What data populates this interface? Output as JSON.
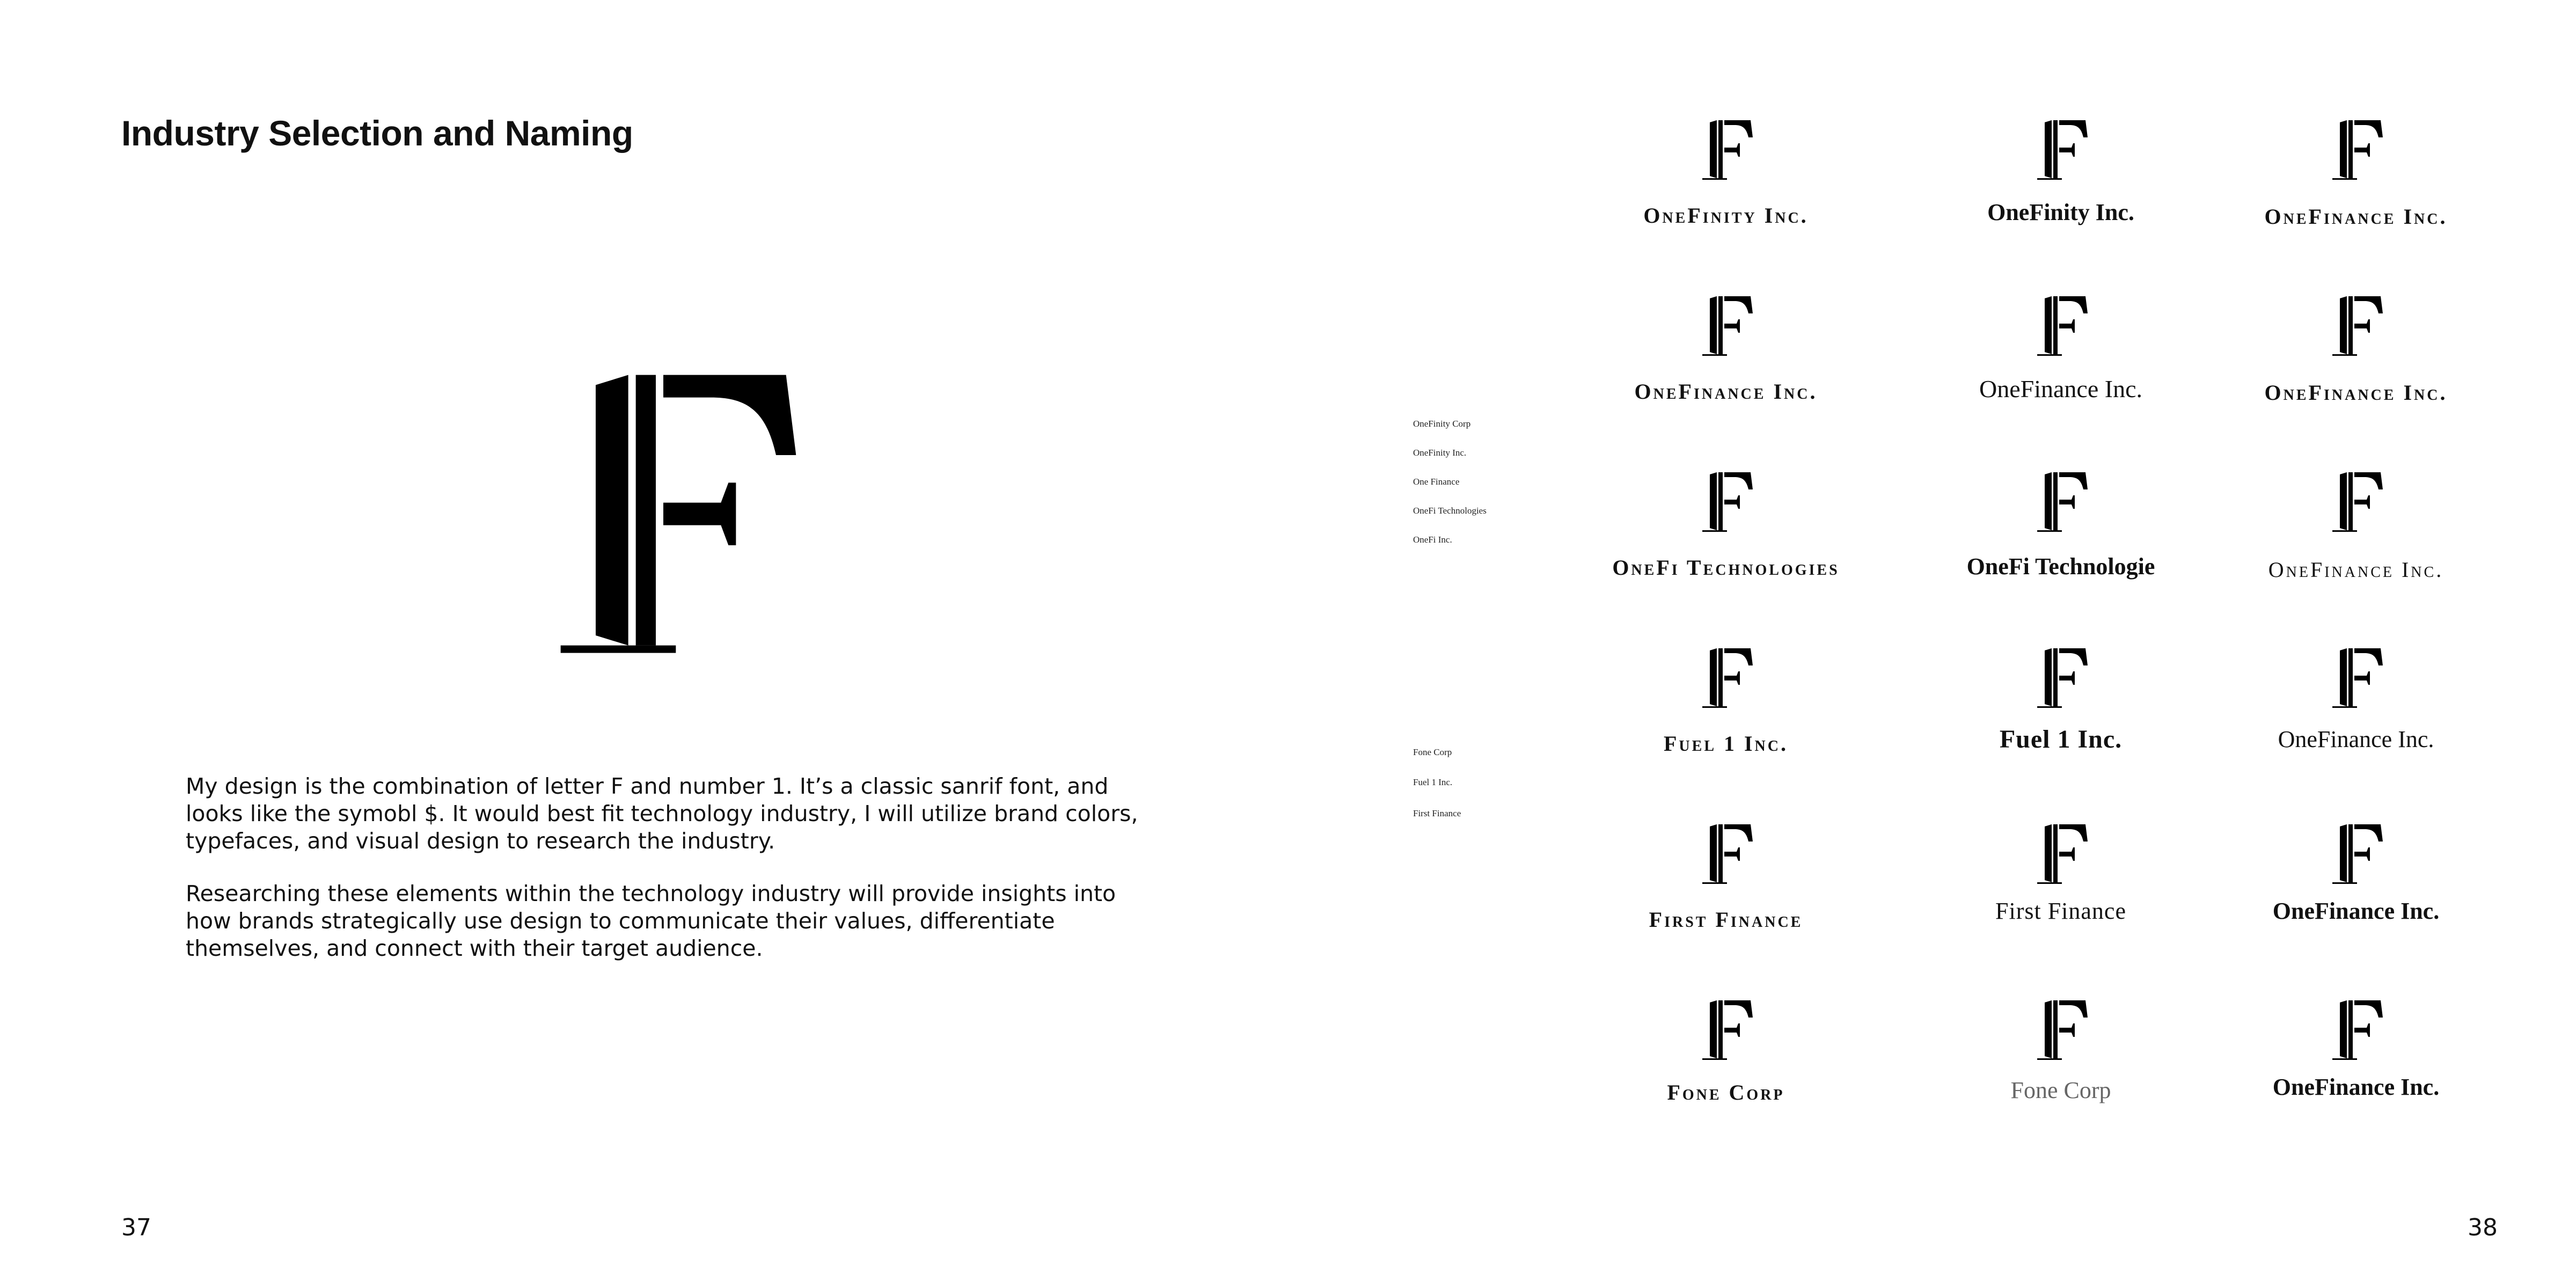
{
  "left_page": {
    "title": "Industry Selection and Naming",
    "mark_icon": "f-one-monogram",
    "paragraph_1": "My design is the combination of letter F and number 1. It’s a classic sanrif font, and looks like the symobl $. It would best fit technology industry, I will utilize brand colors, typefaces, and visual design to research the industry.",
    "paragraph_2": "Researching these elements within the technology industry will provide insights into how brands strategically use design to communicate their values, differentiate themselves, and connect with their target audience.",
    "page_number": "37"
  },
  "right_page": {
    "page_number": "38",
    "name_list_1": [
      "OneFinity Corp",
      "OneFinity Inc.",
      "One Finance",
      "OneFi Technologies",
      "OneFi Inc."
    ],
    "name_list_2": [
      "Fone Corp",
      "Fuel 1 Inc.",
      "First Finance"
    ],
    "logo_grid": [
      [
        "OneFinity Inc.",
        "OneFinity Inc.",
        "OneFinance Inc."
      ],
      [
        "OneFinance Inc.",
        "OneFinance Inc.",
        "OneFinance Inc."
      ],
      [
        "OneFi Technologies",
        "OneFi Technologie",
        "OneFinance Inc."
      ],
      [
        "Fuel 1 Inc.",
        "Fuel 1 Inc.",
        "OneFinance Inc."
      ],
      [
        "First Finance",
        "First Finance",
        "OneFinance Inc."
      ],
      [
        "Fone Corp",
        "Fone Corp",
        "OneFinance Inc."
      ]
    ]
  },
  "colors": {
    "ink": "#111111",
    "muted": "#666666",
    "background": "#ffffff"
  }
}
